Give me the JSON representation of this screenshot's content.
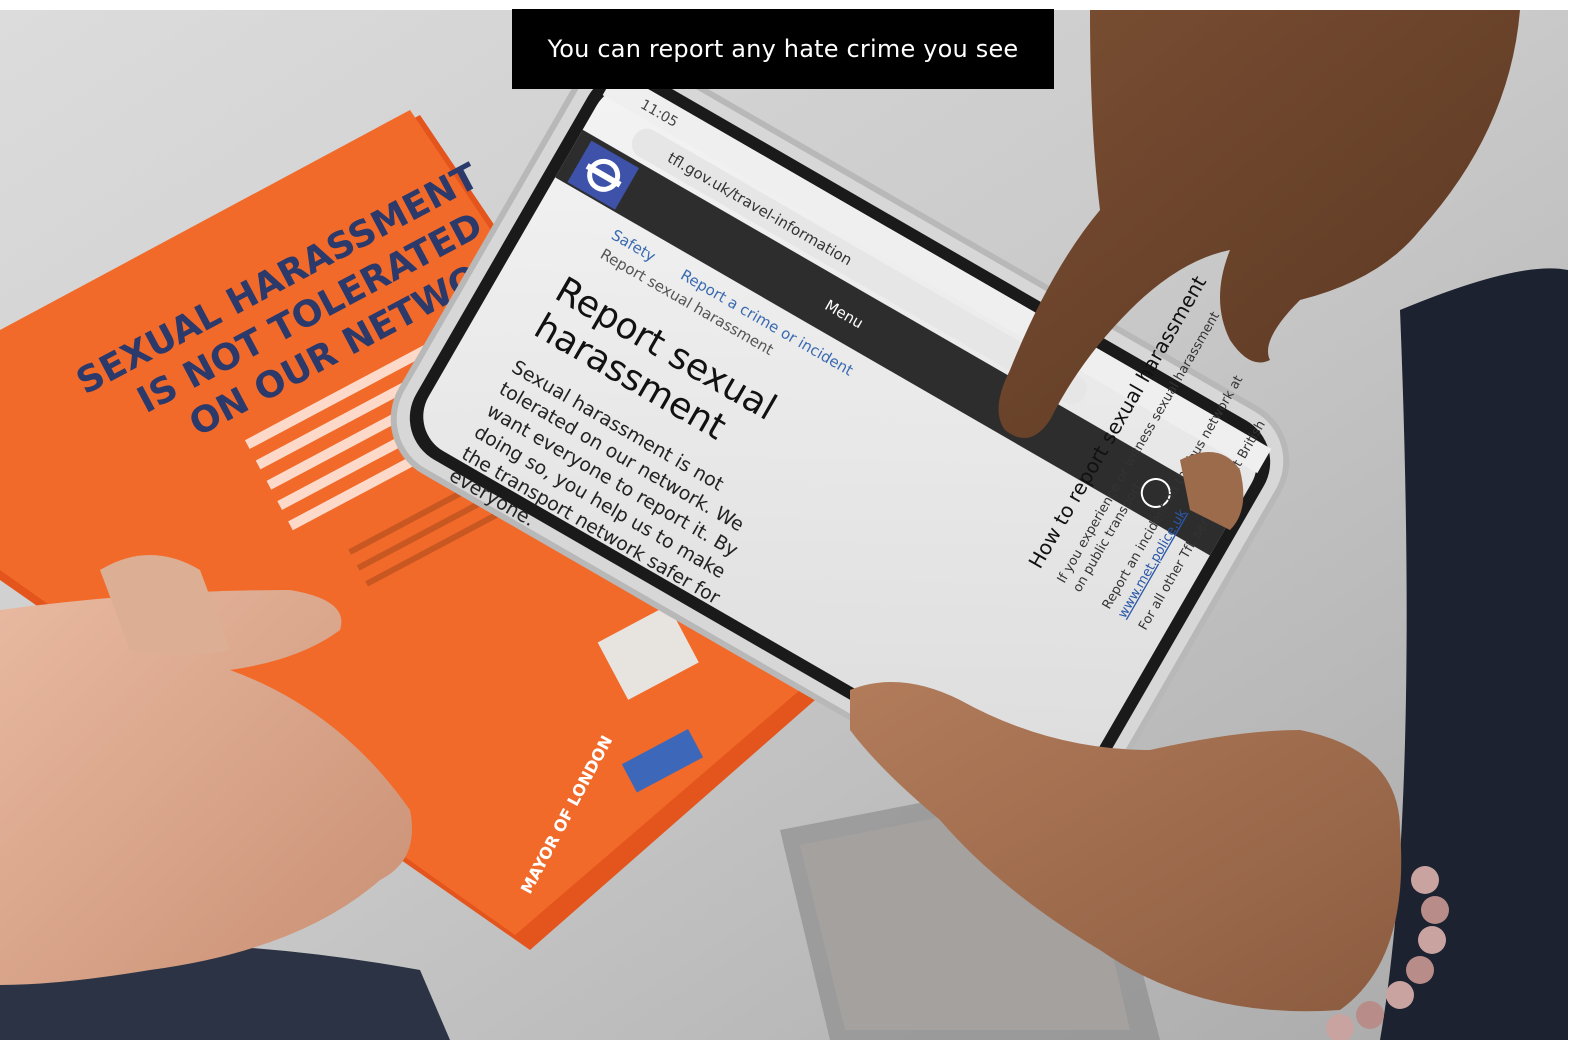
{
  "caption": {
    "text": "You can report any hate crime you see"
  },
  "leaflet": {
    "headline_line1": "SEXUAL HARASSMENT",
    "headline_line2": "IS NOT TOLERATED",
    "headline_line3": "ON OUR NETWORK",
    "brand": "MAYOR OF LONDON",
    "color": "#f26a2a"
  },
  "phone_screen": {
    "status_time": "11:05",
    "url": "tfl.gov.uk/travel-information",
    "menu_label": "Menu",
    "breadcrumb_1": "Safety",
    "breadcrumb_2": "Report a crime or incident",
    "breadcrumb_3": "Report sexual harassment",
    "heading_line1": "Report sexual",
    "heading_line2": "harassment",
    "body_line1": "Sexual harassment is not",
    "body_line2": "tolerated on our network. We",
    "body_line3": "want everyone to report it. By",
    "body_line4": "doing so, you help us to make",
    "body_line5": "the transport network safer for",
    "body_line6": "everyone.",
    "subheading": "How to report sexual harassment",
    "sub_text_line1": "If you experience or witness sexual harassment",
    "sub_text_line2": "on public transport:",
    "bullet_1": "Report an incident on the bus network at",
    "bullet_1_link": "www.met.police.uk",
    "bullet_2": "For all other TfL services, text British"
  }
}
